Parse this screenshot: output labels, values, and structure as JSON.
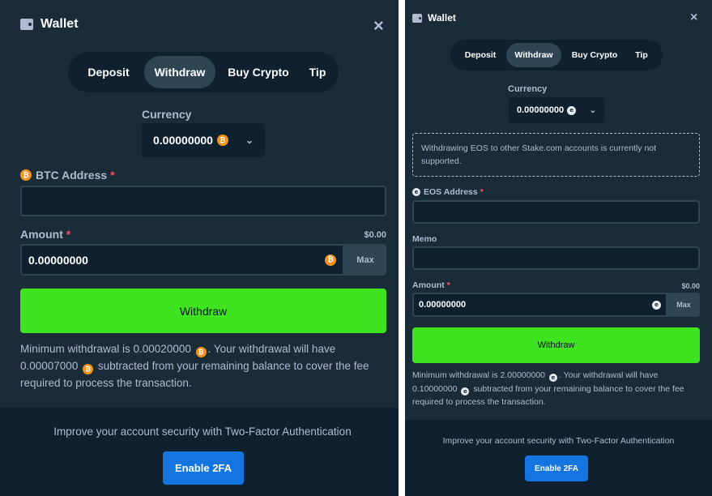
{
  "left": {
    "title": "Wallet",
    "close_icon": "×",
    "tabs": [
      "Deposit",
      "Withdraw",
      "Buy Crypto",
      "Tip"
    ],
    "active_tab": "Withdraw",
    "currency_label": "Currency",
    "currency_value": "0.00000000",
    "coin_icon": "bitcoin-icon",
    "address_label": "BTC Address",
    "required_mark": "*",
    "address_value": "",
    "amount_label": "Amount",
    "amount_usd": "$0.00",
    "amount_value": "0.00000000",
    "max_label": "Max",
    "withdraw_label": "Withdraw",
    "note_part1": "Minimum withdrawal is 0.00020000",
    "note_part2": ". Your withdrawal will have",
    "note_part3": "0.00007000",
    "note_part4": "subtracted from your remaining balance to cover the fee required to process the transaction.",
    "security_msg": "Improve your account security with Two-Factor Authentication",
    "enable_2fa": "Enable 2FA"
  },
  "right": {
    "title": "Wallet",
    "close_icon": "×",
    "tabs": [
      "Deposit",
      "Withdraw",
      "Buy Crypto",
      "Tip"
    ],
    "active_tab": "Withdraw",
    "currency_label": "Currency",
    "currency_value": "0.00000000",
    "coin_icon": "eos-icon",
    "warning": "Withdrawing EOS to other Stake.com accounts is currently not supported.",
    "address_label": "EOS Address",
    "required_mark": "*",
    "memo_label": "Memo",
    "amount_label": "Amount",
    "amount_usd": "$0.00",
    "amount_value": "0.00000000",
    "max_label": "Max",
    "withdraw_label": "Withdraw",
    "note_part1": "Minimum withdrawal is 2.00000000",
    "note_part2": ". Your withdrawal will have",
    "note_part3": "0.10000000",
    "note_part4": "subtracted from your remaining balance to cover the fee required to process the transaction.",
    "security_msg": "Improve your account security with Two-Factor Authentication",
    "enable_2fa": "Enable 2FA"
  },
  "colors": {
    "panel_bg": "#1a2c38",
    "input_bg": "#0f212e",
    "tab_active": "#2f4553",
    "withdraw_green": "#3de41f",
    "enable_blue": "#1475e1",
    "btc_orange": "#f7931a"
  }
}
